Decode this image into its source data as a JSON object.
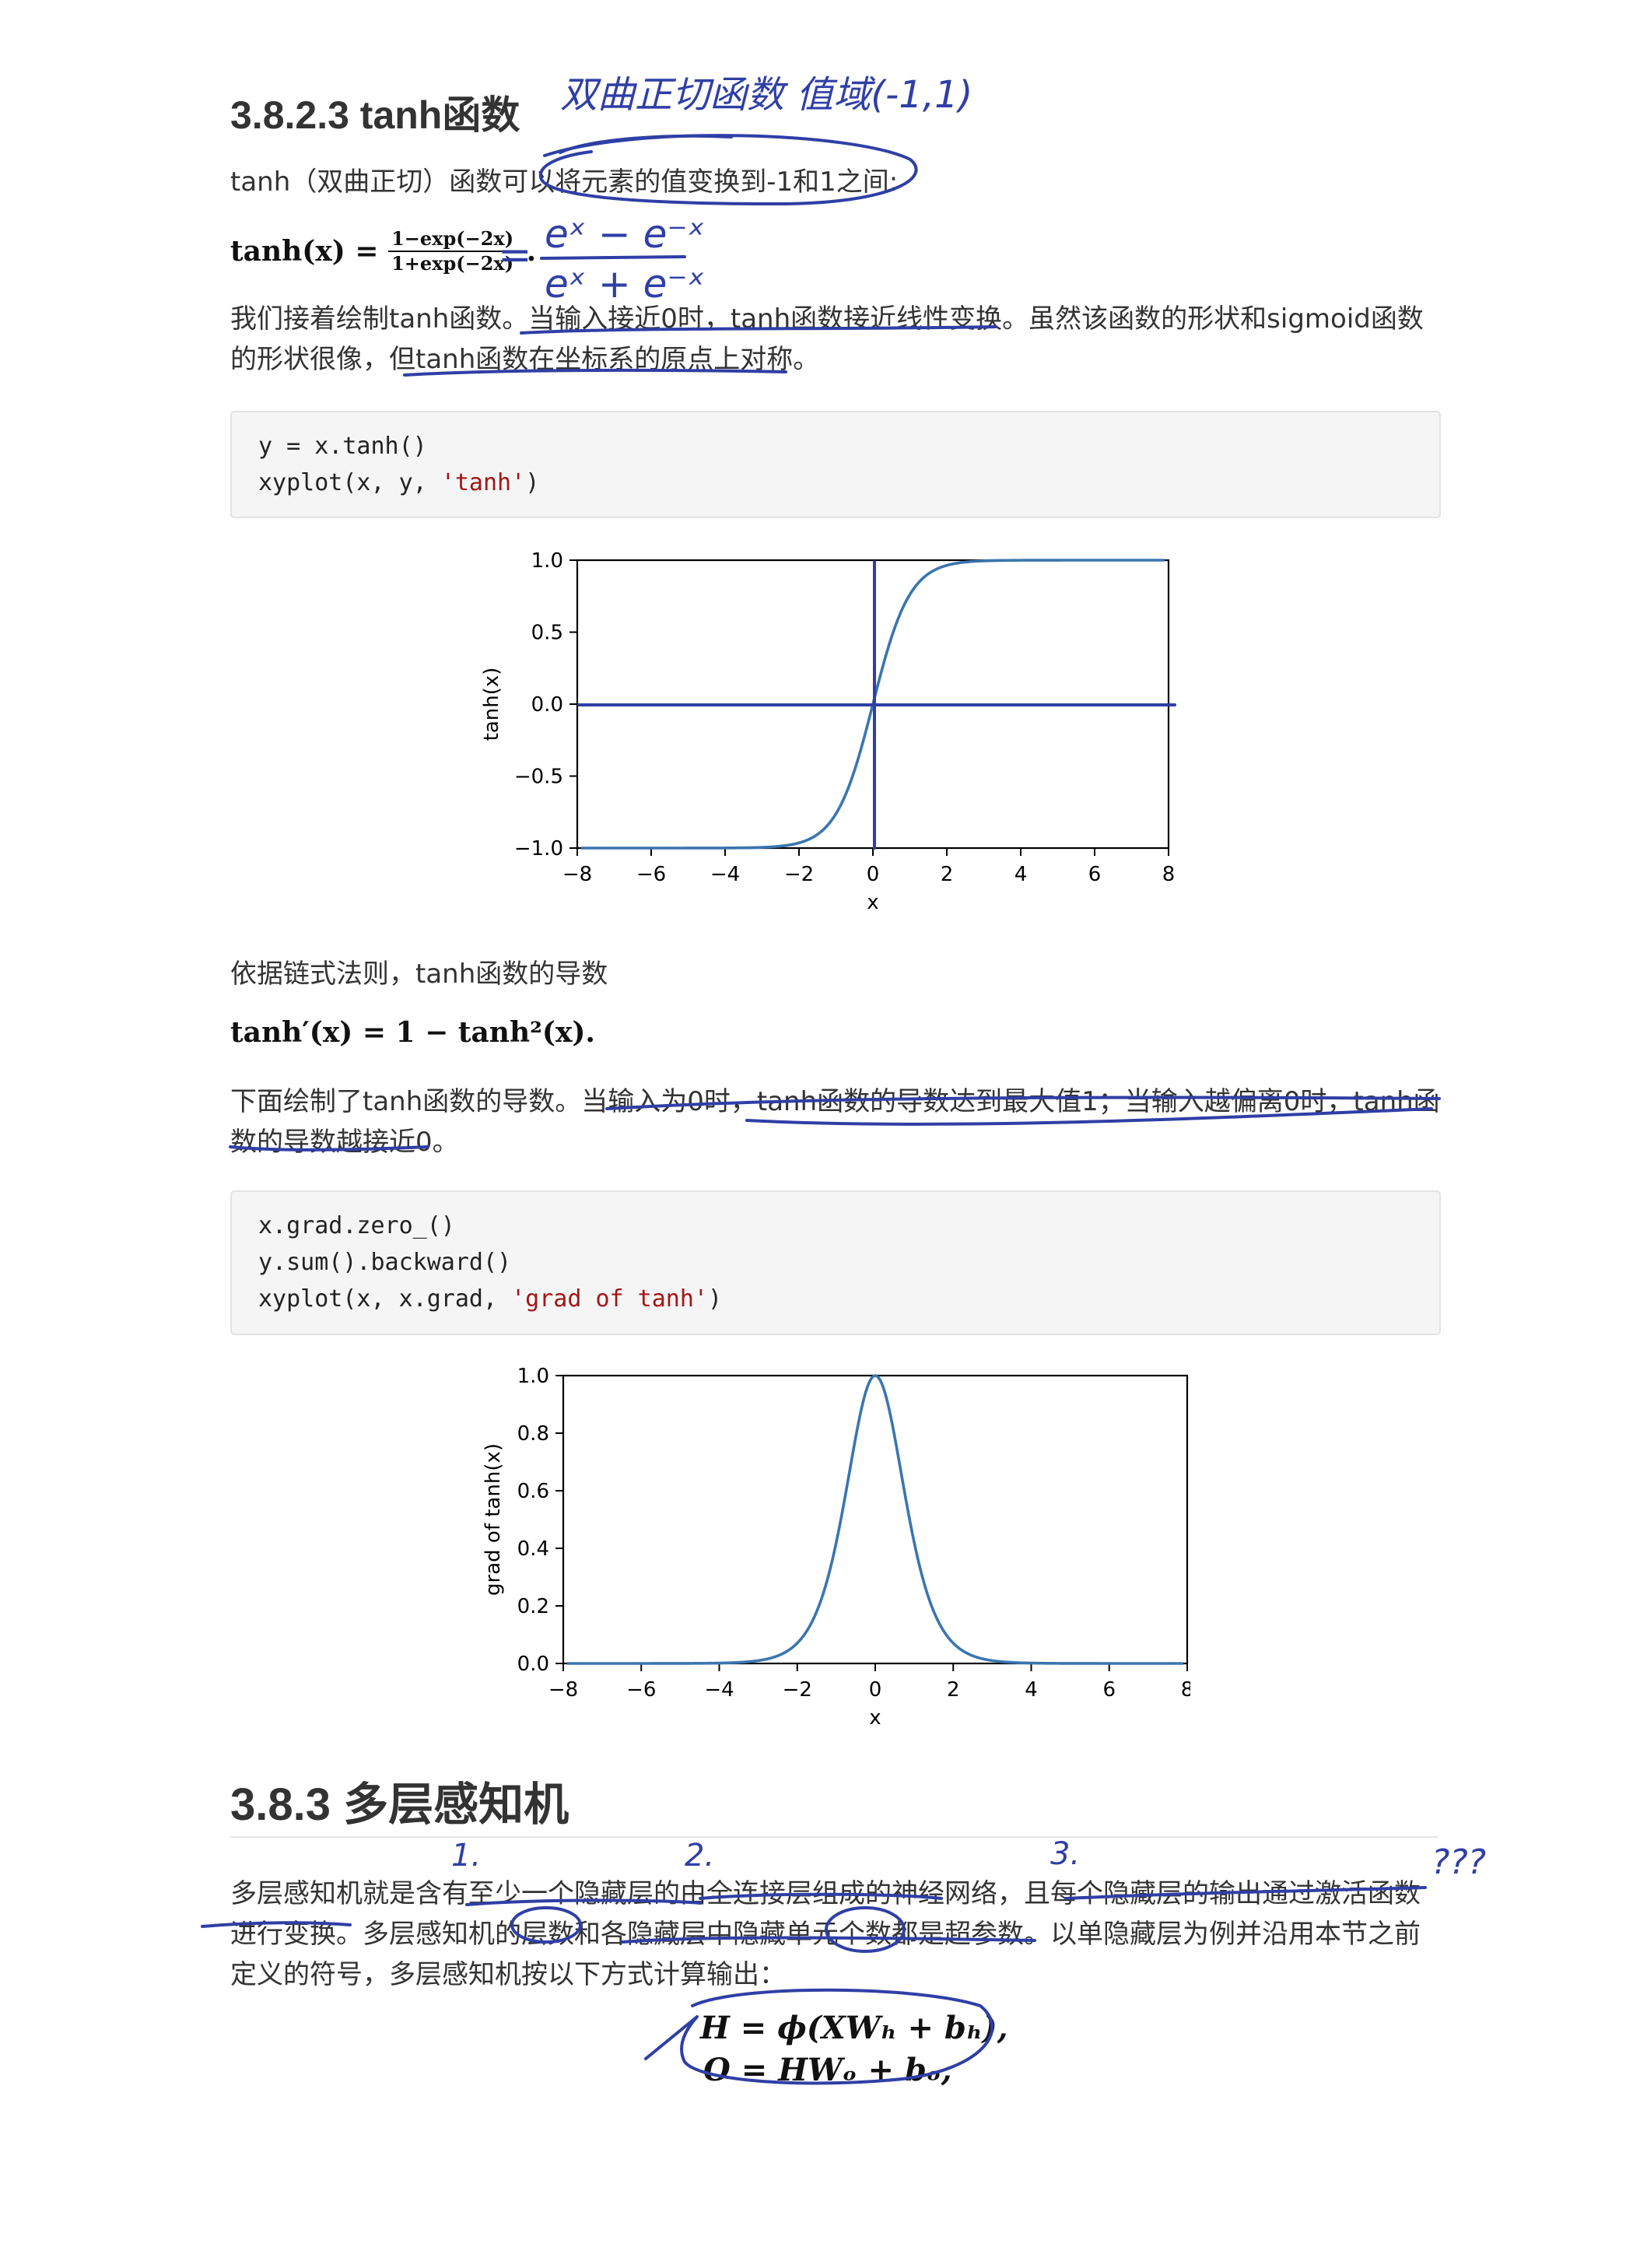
{
  "section_tanh": {
    "title": "3.8.2.3 tanh函数",
    "intro": "tanh（双曲正切）函数可以将元素的值变换到-1和1之间:",
    "formula_lhs": "tanh(x) = ",
    "formula_num": "1−exp(−2x)",
    "formula_den": "1+exp(−2x)",
    "formula_end": ".",
    "desc_line1": "我们接着绘制tanh函数。当输入接近0时，tanh函数接近线性变换。虽然该函数的形状和sigmoid函数",
    "desc_line2": "的形状很像，但tanh函数在坐标系的原点上对称。",
    "code1": [
      "y = x.tanh()",
      "xyplot(x, y, ",
      "'tanh'",
      ")"
    ],
    "deriv_intro": "依据链式法则，tanh函数的导数",
    "deriv_formula": "tanh′(x) = 1 − tanh²(x).",
    "deriv_desc_line1": "下面绘制了tanh函数的导数。当输入为0时，tanh函数的导数达到最大值1；当输入越偏离0时，tanh函",
    "deriv_desc_line2": "数的导数越接近0。",
    "code2": [
      "x.grad.zero_()",
      "y.sum().backward()",
      "xyplot(x, x.grad, ",
      "'grad of tanh'",
      ")"
    ]
  },
  "section_mlp": {
    "title": "3.8.3 多层感知机",
    "line1": "多层感知机就是含有至少一个隐藏层的由全连接层组成的神经网络，且每个隐藏层的输出通过激活函数",
    "line2": "进行变换。多层感知机的层数和各隐藏层中隐藏单元个数都是超参数。以单隐藏层为例并沿用本节之前",
    "line3": "定义的符号，多层感知机按以下方式计算输出：",
    "eq1": "H = ϕ(XWₕ + bₕ),",
    "eq2": "O = HWₒ + bₒ,"
  },
  "handwriting": {
    "title_note": "双曲正切函数   值域(-1,1)",
    "formula_note_num": "eˣ − e⁻ˣ",
    "formula_note_den": "eˣ + e⁻ˣ",
    "eq_sign": "=",
    "mark1": "1.",
    "mark2": "2.",
    "mark3": "3.",
    "qmarks": "???"
  },
  "chart_data": [
    {
      "type": "line",
      "title": "",
      "xlabel": "x",
      "ylabel": "tanh(x)",
      "xlim": [
        -8,
        8
      ],
      "ylim": [
        -1.0,
        1.0
      ],
      "xticks": [
        "−8",
        "−6",
        "−4",
        "−2",
        "0",
        "2",
        "4",
        "6",
        "8"
      ],
      "yticks": [
        "1.0",
        "0.5",
        "0.0",
        "−0.5",
        "−1.0"
      ],
      "series": [
        {
          "function": "tanh(x)",
          "x_range": [
            -7.9,
            7.9
          ],
          "color": "#3a75b0"
        }
      ],
      "annotations": "hand-drawn axes through origin",
      "grid": false
    },
    {
      "type": "line",
      "title": "",
      "xlabel": "x",
      "ylabel": "grad of tanh(x)",
      "xlim": [
        -8,
        8
      ],
      "ylim": [
        0.0,
        1.0
      ],
      "xticks": [
        "−8",
        "−6",
        "−4",
        "−2",
        "0",
        "2",
        "4",
        "6",
        "8"
      ],
      "yticks": [
        "1.0",
        "0.8",
        "0.6",
        "0.4",
        "0.2",
        "0.0"
      ],
      "series": [
        {
          "function": "1 - tanh(x)^2",
          "x_range": [
            -7.9,
            7.9
          ],
          "color": "#3a75b0"
        }
      ],
      "grid": false
    }
  ]
}
